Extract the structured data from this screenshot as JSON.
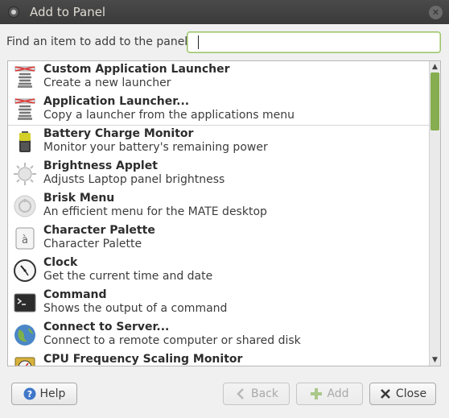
{
  "window": {
    "title": "Add to Panel"
  },
  "find": {
    "label": "Find an item to add to the panel:",
    "value": "",
    "placeholder": ""
  },
  "items": [
    {
      "name": "Custom Application Launcher",
      "desc": "Create a new launcher",
      "icon": "launcher-spring-icon"
    },
    {
      "name": "Application Launcher...",
      "desc": "Copy a launcher from the applications menu",
      "icon": "launcher-spring-icon"
    },
    {
      "name": "Battery Charge Monitor",
      "desc": "Monitor your battery's remaining power",
      "icon": "battery-icon"
    },
    {
      "name": "Brightness Applet",
      "desc": "Adjusts Laptop panel brightness",
      "icon": "brightness-sun-icon"
    },
    {
      "name": "Brisk Menu",
      "desc": "An efficient menu for the MATE desktop",
      "icon": "brisk-menu-icon"
    },
    {
      "name": "Character Palette",
      "desc": "Character Palette",
      "icon": "character-palette-icon"
    },
    {
      "name": "Clock",
      "desc": "Get the current time and date",
      "icon": "clock-icon"
    },
    {
      "name": "Command",
      "desc": "Shows the output of a command",
      "icon": "terminal-icon"
    },
    {
      "name": "Connect to Server...",
      "desc": "Connect to a remote computer or shared disk",
      "icon": "globe-icon"
    },
    {
      "name": "CPU Frequency Scaling Monitor",
      "desc": "",
      "icon": "cpu-gauge-icon"
    }
  ],
  "buttons": {
    "help": "Help",
    "back": "Back",
    "add": "Add",
    "close": "Close"
  },
  "colors": {
    "accent": "#87a752",
    "titlebar": "#3c3c3c"
  }
}
